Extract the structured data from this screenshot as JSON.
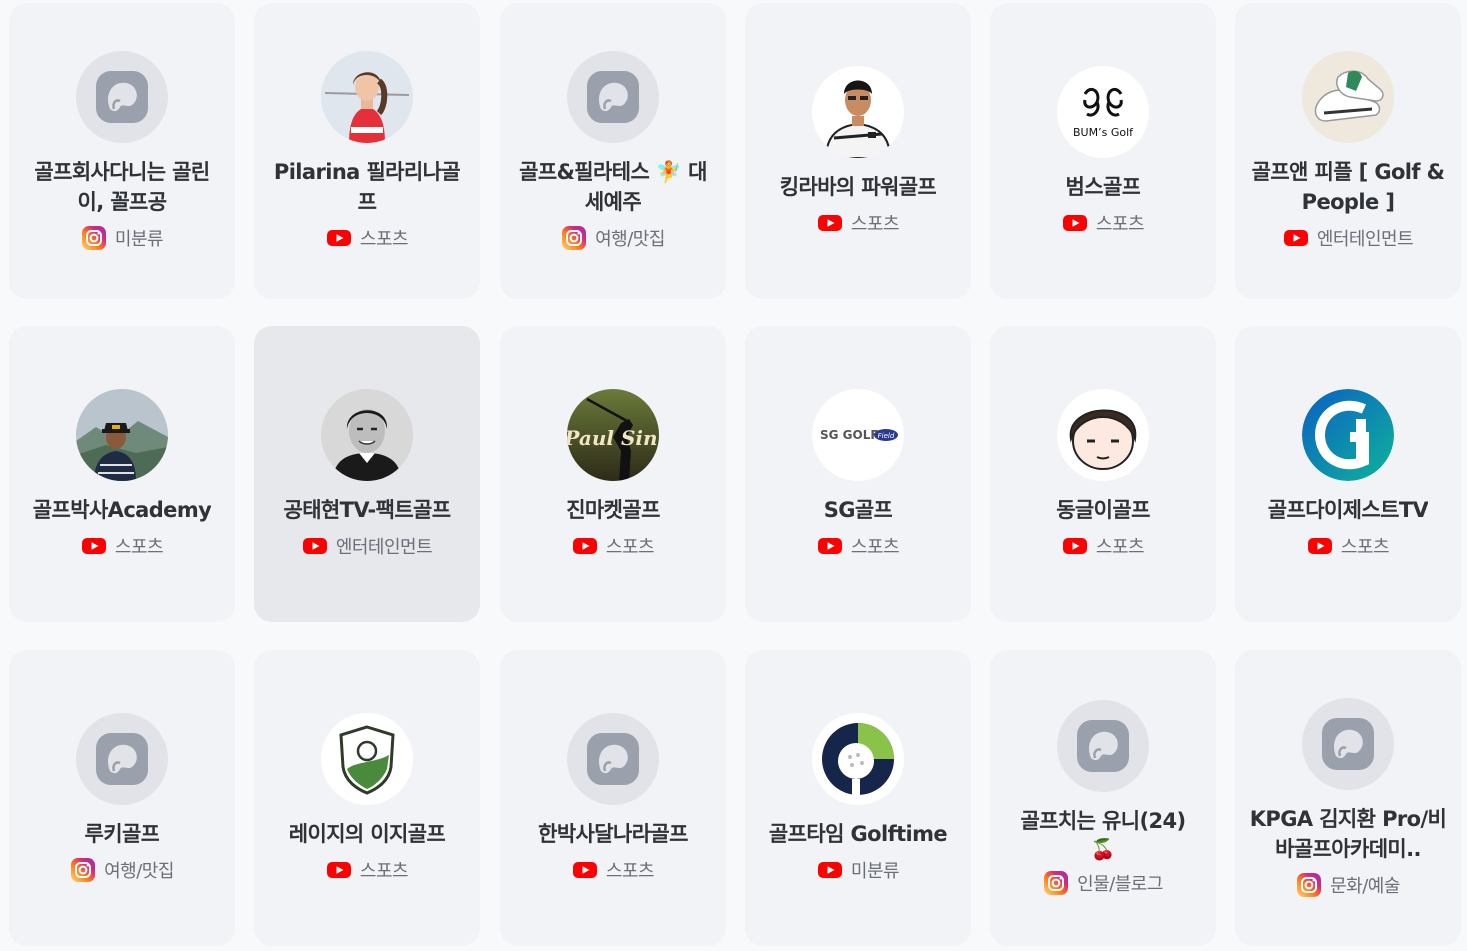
{
  "channels": [
    {
      "name": "골프회사다니는 골린이, 꼴프공",
      "platform": "instagram-icon",
      "category": "미분류",
      "avatar": "placeholder"
    },
    {
      "name": "Pilarina 필라리나골프",
      "platform": "youtube-icon",
      "category": "스포츠",
      "avatar": "photo-woman-golf"
    },
    {
      "name": "골프&필라테스 🧚 대세예주",
      "platform": "instagram-icon",
      "category": "여행/맛집",
      "avatar": "placeholder"
    },
    {
      "name": "킹라바의 파워골프",
      "platform": "youtube-icon",
      "category": "스포츠",
      "avatar": "photo-man-shirt"
    },
    {
      "name": "범스골프",
      "platform": "youtube-icon",
      "category": "스포츠",
      "avatar": "logo-bums-golf"
    },
    {
      "name": "골프앤 피플 [ Golf & People ]",
      "platform": "youtube-icon",
      "category": "엔터테인먼트",
      "avatar": "photo-golf-shoes"
    },
    {
      "name": "골프박사Academy",
      "platform": "youtube-icon",
      "category": "스포츠",
      "avatar": "photo-man-mountain"
    },
    {
      "name": "공태현TV-팩트골프",
      "platform": "youtube-icon",
      "category": "엔터테인먼트",
      "avatar": "photo-man-bw"
    },
    {
      "name": "진마켓골프",
      "platform": "youtube-icon",
      "category": "스포츠",
      "avatar": "logo-paul-sin"
    },
    {
      "name": "SG골프",
      "platform": "youtube-icon",
      "category": "스포츠",
      "avatar": "logo-sg-golf"
    },
    {
      "name": "동글이골프",
      "platform": "youtube-icon",
      "category": "스포츠",
      "avatar": "illustration-face"
    },
    {
      "name": "골프다이제스트TV",
      "platform": "youtube-icon",
      "category": "스포츠",
      "avatar": "logo-golf-digest"
    },
    {
      "name": "루키골프",
      "platform": "instagram-icon",
      "category": "여행/맛집",
      "avatar": "placeholder"
    },
    {
      "name": "레이지의 이지골프",
      "platform": "youtube-icon",
      "category": "스포츠",
      "avatar": "logo-shield-ball"
    },
    {
      "name": "한박사달나라골프",
      "platform": "youtube-icon",
      "category": "스포츠",
      "avatar": "placeholder"
    },
    {
      "name": "골프타임 Golftime",
      "platform": "youtube-icon",
      "category": "미분류",
      "avatar": "logo-golftime"
    },
    {
      "name": "골프치는 유니(24)",
      "name_extra": "🍒",
      "platform": "instagram-icon",
      "category": "인물/블로그",
      "avatar": "placeholder"
    },
    {
      "name": "KPGA 김지환 Pro/비바골프아카데미..",
      "platform": "instagram-icon",
      "category": "문화/예술",
      "avatar": "placeholder"
    }
  ],
  "colors": {
    "card_bg": "#f2f3f6",
    "card_hover_bg": "#e6e8ec",
    "youtube_red": "#ff0000",
    "instagram_gradient": [
      "#feda75",
      "#d62976",
      "#962fbf"
    ],
    "placeholder_bg": "#e1e3e8",
    "placeholder_icon": "#9aa0ac"
  }
}
